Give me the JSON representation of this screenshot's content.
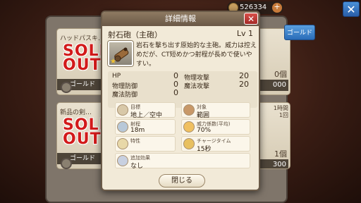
{
  "topbar": {
    "currency": "526334",
    "plus": "+"
  },
  "global_close": "✕",
  "background": {
    "cards": [
      {
        "title": "ハッドパスキ…",
        "sold_out": "SOLD OUT",
        "gold": "ゴールド"
      },
      {
        "title": "新品の剣…",
        "sold_out": "SOLD OUT",
        "gold": "ゴールド"
      }
    ],
    "right_cards": [
      {
        "count": "0個",
        "box": "000"
      },
      {
        "tag": "1時間",
        "sub": "1回",
        "count": "1個",
        "box": "300"
      }
    ],
    "gold_button": "ゴールド"
  },
  "dialog": {
    "title": "詳細情報",
    "close": "✕",
    "item": {
      "name": "射石砲（主砲）",
      "level": "Lv 1",
      "description": "岩石を撃ち出す原始的な主砲。威力は控えめだが、CT短めかつ射程が長めで使いやすい。",
      "star": "★"
    },
    "stats": [
      {
        "label": "HP",
        "value": "0"
      },
      {
        "label": "物理防御",
        "value": "0"
      },
      {
        "label": "魔法防御",
        "value": "0"
      },
      {
        "label": "物理攻撃",
        "value": "20"
      },
      {
        "label": "魔法攻撃",
        "value": "20"
      }
    ],
    "attributes": [
      {
        "label": "目標",
        "value": "地上／空中",
        "icon": "target-icon"
      },
      {
        "label": "対象",
        "value": "範囲",
        "icon": "area-icon"
      },
      {
        "label": "射程",
        "value": "18m",
        "icon": "range-icon"
      },
      {
        "label": "威力係数(平均)",
        "value": "70%",
        "icon": "power-icon"
      },
      {
        "label": "特性",
        "value": "",
        "icon": "sword-icon"
      },
      {
        "label": "チャージタイム",
        "value": "15秒",
        "icon": "charge-icon"
      },
      {
        "label": "追加効果",
        "value": "なし",
        "icon": "effect-icon"
      }
    ],
    "close_button": "閉じる"
  }
}
